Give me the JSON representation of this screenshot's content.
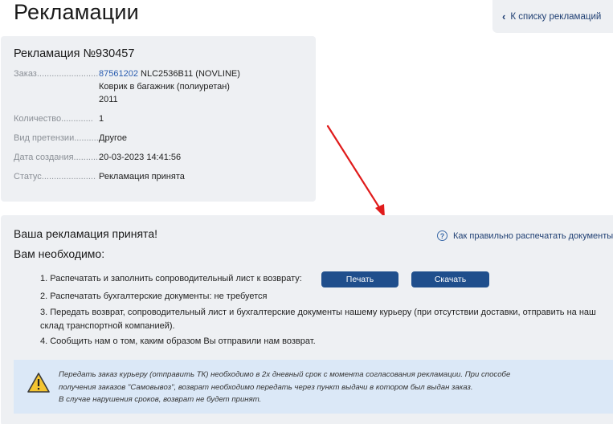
{
  "page": {
    "title": "Рекламации"
  },
  "back_link": {
    "label": "К списку рекламаций"
  },
  "claim": {
    "title": "Рекламация №930457",
    "fields": [
      {
        "label": "Заказ.........................",
        "link": "87561202",
        "value_lines": [
          "NLC2536B11 (NOVLINE)",
          "Коврик в багажник (полиуретан)",
          "2011"
        ]
      },
      {
        "label": "Количество.............",
        "value": "1"
      },
      {
        "label": "Вид претензии..........",
        "value": "Другое"
      },
      {
        "label": "Дата создания..........",
        "value": "20-03-2023 14:41:56"
      },
      {
        "label": "Статус......................",
        "value": "Рекламация принята"
      }
    ]
  },
  "accepted": {
    "title": "Ваша рекламация принята!",
    "need": "Вам необходимо:",
    "help_link": "Как правильно распечатать документы",
    "steps": [
      "1. Распечатать и заполнить сопроводительный лист к возврату:",
      "2. Распечатать бухгалтерские документы: не требуется",
      "3. Передать возврат, сопроводительный лист и бухгалтерские документы нашему курьеру (при отсутствии доставки, отправить на наш",
      "склад транспортной компанией).",
      "4. Сообщить нам о том, каким образом Вы отправили нам возврат."
    ],
    "print_button": "Печать",
    "download_button": "Скачать"
  },
  "warning": {
    "lines": [
      "Передать заказ курьеру (отправить ТК) необходимо в 2х дневный срок с момента согласования рекламации. При способе",
      "получения заказов \"Самовывоз\", возврат необходимо передать через пункт выдачи в котором был выдан заказ.",
      "В случае нарушения сроков, возврат не будет принят."
    ]
  },
  "colors": {
    "accent": "#1f4e8c",
    "link": "#2a5db0",
    "panel": "#eef0f3",
    "warning_bg": "#dbe8f7",
    "arrow": "#e01b1b"
  }
}
